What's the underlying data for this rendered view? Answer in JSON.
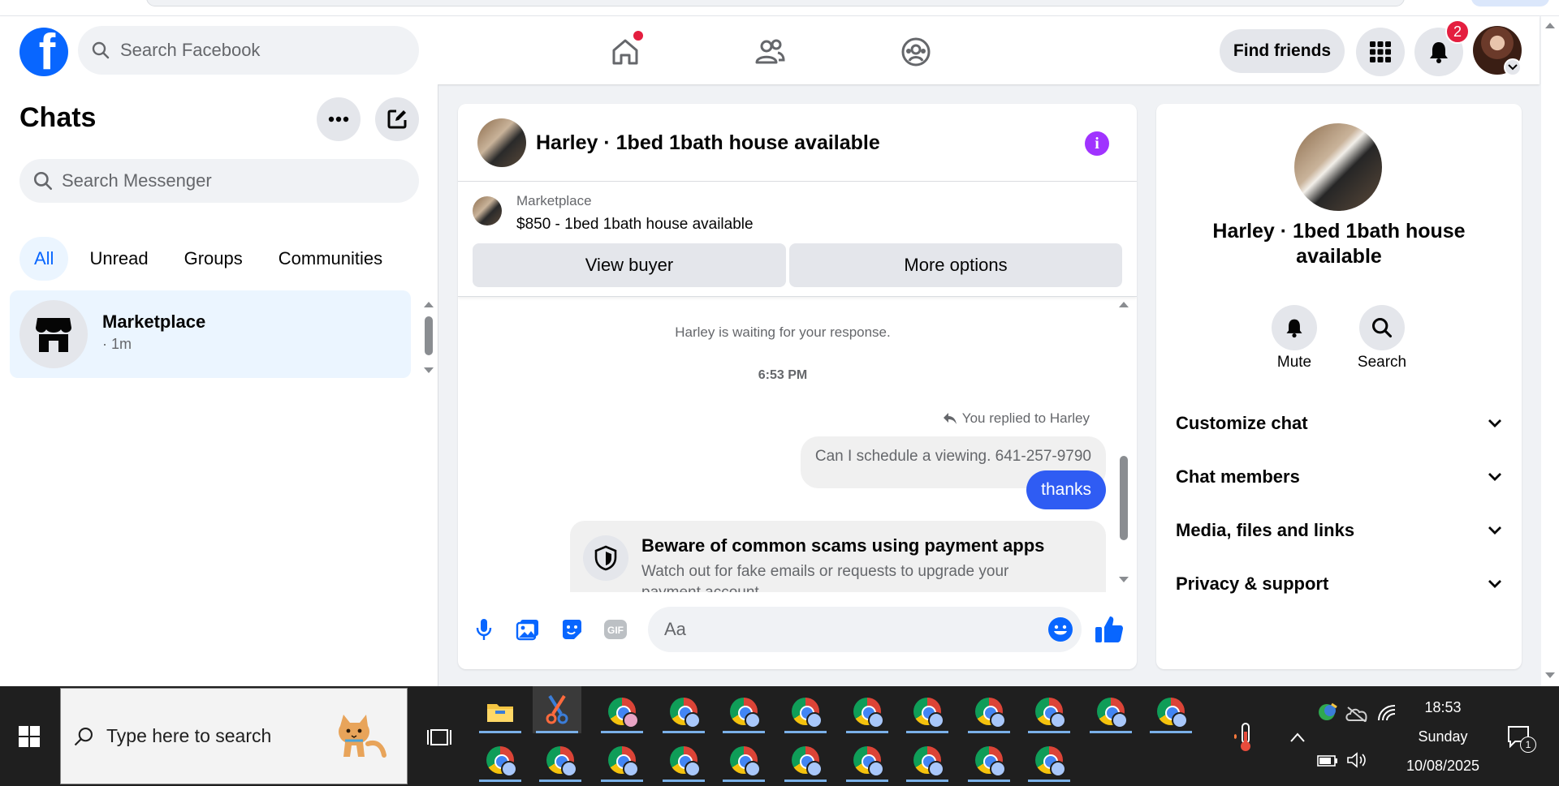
{
  "header": {
    "search_placeholder": "Search Facebook",
    "find_friends": "Find friends",
    "notification_count": "2"
  },
  "chats": {
    "title": "Chats",
    "search_placeholder": "Search Messenger",
    "tabs": [
      "All",
      "Unread",
      "Groups",
      "Communities"
    ],
    "items": [
      {
        "name": "Marketplace",
        "time": "· 1m"
      }
    ]
  },
  "conversation": {
    "title": "Harley · 1bed 1bath house available",
    "marketplace_label": "Marketplace",
    "listing": "$850 - 1bed 1bath house available",
    "view_buyer": "View buyer",
    "more_options": "More options",
    "waiting_text": "Harley is waiting for your response.",
    "timestamp": "6:53 PM",
    "replied_text": "You replied to Harley",
    "message_in": "Can I schedule a viewing.  641-257-9790",
    "message_out": "thanks",
    "scam_title": "Beware of common scams using payment apps",
    "scam_desc": "Watch out for fake emails or requests to upgrade your payment account.",
    "composer_placeholder": "Aa"
  },
  "details": {
    "title": "Harley · 1bed 1bath house available",
    "mute": "Mute",
    "search": "Search",
    "sections": [
      "Customize chat",
      "Chat members",
      "Media, files and links",
      "Privacy & support"
    ]
  },
  "taskbar": {
    "search_placeholder": "Type here to search",
    "time": "18:53",
    "day": "Sunday",
    "date": "10/08/2025",
    "notification_count": "1"
  },
  "colors": {
    "brand": "#0866ff",
    "outgoing_bubble": "#2f5cf3",
    "badge": "#e41e3f",
    "info_icon": "#a033ff"
  }
}
